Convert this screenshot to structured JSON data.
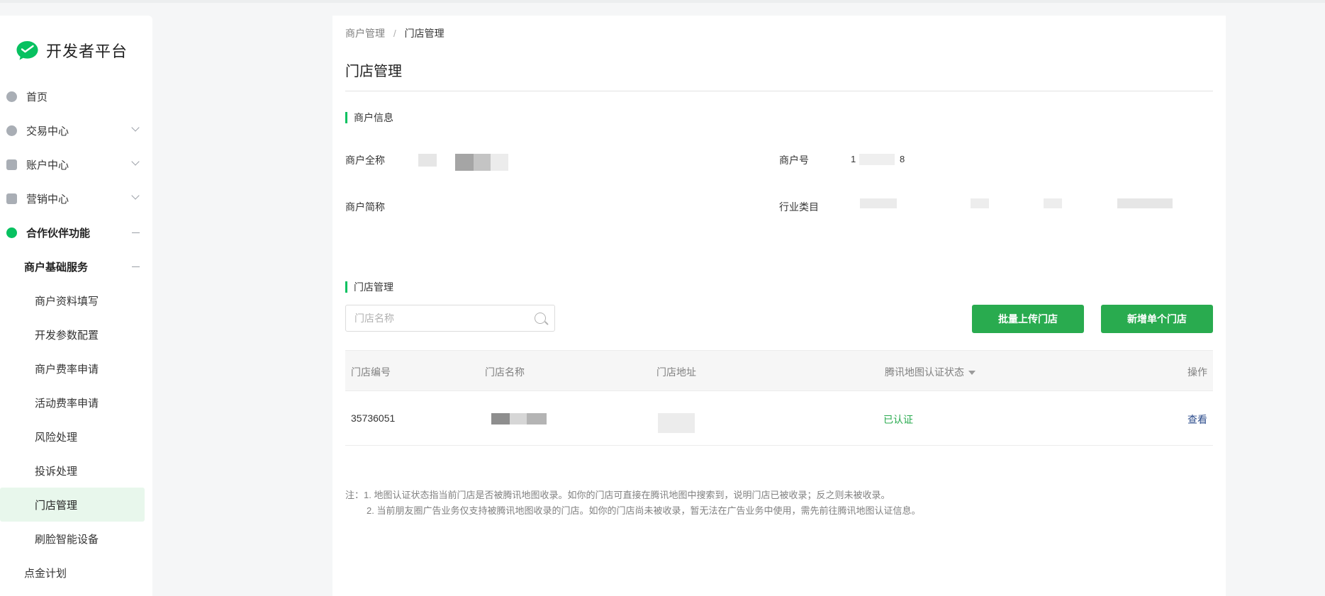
{
  "app": {
    "logo_text": "开发者平台",
    "brand_color": "#07c160",
    "button_color": "#29ab4f"
  },
  "sidebar": {
    "items": [
      {
        "label": "首页",
        "icon": "home-icon"
      },
      {
        "label": "交易中心",
        "icon": "exchange-icon"
      },
      {
        "label": "账户中心",
        "icon": "account-icon"
      },
      {
        "label": "营销中心",
        "icon": "marketing-icon"
      },
      {
        "label": "合作伙伴功能",
        "icon": "partner-icon"
      },
      {
        "label": "商户基础服务"
      },
      {
        "label": "商户资料填写"
      },
      {
        "label": "开发参数配置"
      },
      {
        "label": "商户费率申请"
      },
      {
        "label": "活动费率申请"
      },
      {
        "label": "风险处理"
      },
      {
        "label": "投诉处理"
      },
      {
        "label": "门店管理"
      },
      {
        "label": "刷脸智能设备"
      },
      {
        "label": "点金计划"
      }
    ]
  },
  "breadcrumb": {
    "parent": "商户管理",
    "separator": "/",
    "current": "门店管理"
  },
  "page": {
    "title": "门店管理"
  },
  "merchant_info": {
    "section_title": "商户信息",
    "full_name_label": "商户全称",
    "merchant_id_label": "商户号",
    "merchant_id_value_start": "1",
    "merchant_id_value_end": "8",
    "short_name_label": "商户简称",
    "industry_label": "行业类目"
  },
  "store_section": {
    "section_title": "门店管理",
    "search_placeholder": "门店名称",
    "batch_upload_button": "批量上传门店",
    "add_single_button": "新增单个门店"
  },
  "table": {
    "columns": [
      "门店编号",
      "门店名称",
      "门店地址",
      "腾讯地图认证状态",
      "操作"
    ],
    "rows": [
      {
        "store_id": "35736051",
        "status": "已认证",
        "action": "查看"
      }
    ]
  },
  "notes": {
    "line1": "注：1. 地图认证状态指当前门店是否被腾讯地图收录。如你的门店可直接在腾讯地图中搜索到，说明门店已被收录；反之则未被收录。",
    "line2": "2. 当前朋友圈广告业务仅支持被腾讯地图收录的门店。如你的门店尚未被收录，暂无法在广告业务中使用，需先前往腾讯地图认证信息。"
  }
}
